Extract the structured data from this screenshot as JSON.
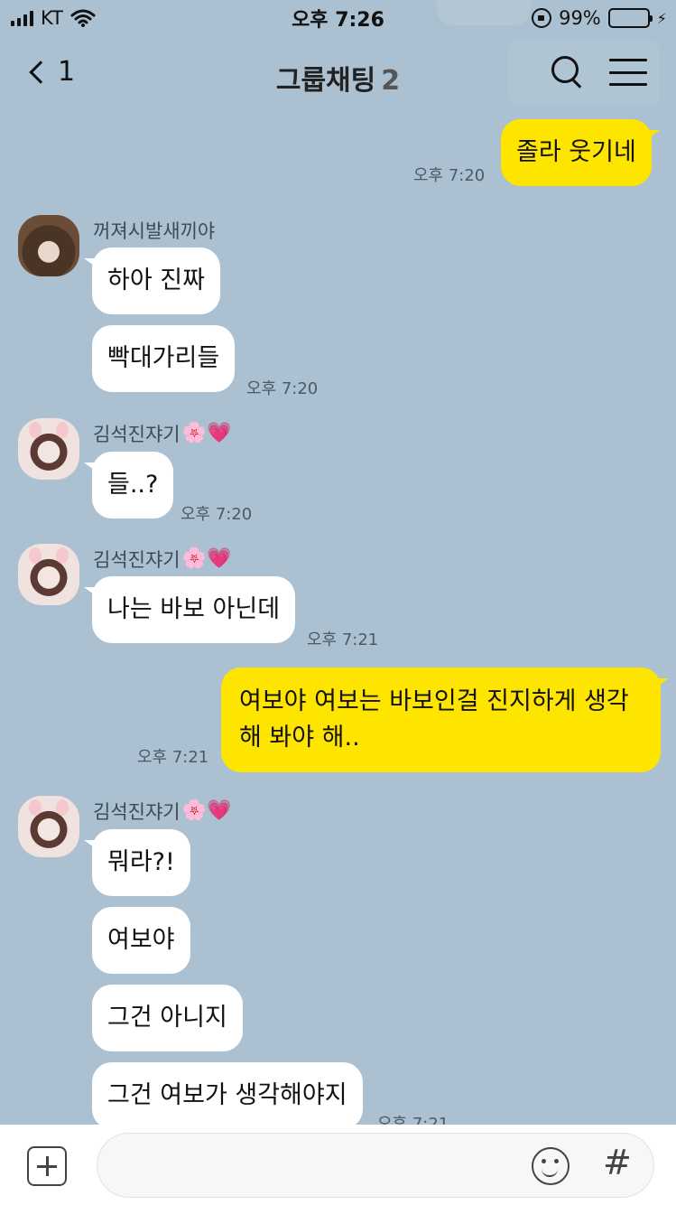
{
  "status_bar": {
    "carrier": "KT",
    "time": "오후 7:26",
    "battery": "99%",
    "battery_level": 0.99,
    "icons": [
      "signal-icon",
      "wifi-icon",
      "rotation-lock-icon",
      "battery-icon",
      "charging-icon"
    ]
  },
  "header": {
    "back_count": "1",
    "title": "그룹채팅",
    "member_count": "2",
    "icons": [
      "back-chevron-icon",
      "search-icon",
      "menu-icon"
    ]
  },
  "messages": [
    {
      "id": "m1",
      "direction": "out",
      "text": "졸라 웃기네",
      "time": "오후 7:20"
    },
    {
      "id": "m2",
      "direction": "in",
      "sender": "꺼져시발새끼야",
      "text": "하아 진짜"
    },
    {
      "id": "m3",
      "direction": "in",
      "text": "빡대가리들",
      "time": "오후 7:20"
    },
    {
      "id": "m4",
      "direction": "in",
      "sender": "김석진쟈기",
      "sender_emojis": "🌸💗",
      "text": "들..?",
      "time": "오후 7:20"
    },
    {
      "id": "m5",
      "direction": "in",
      "sender": "김석진쟈기",
      "sender_emojis": "🌸💗",
      "text": "나는 바보 아닌데",
      "time": "오후 7:21"
    },
    {
      "id": "m6",
      "direction": "out",
      "text": "여보야 여보는 바보인걸 진지하게 생각해 봐야 해..",
      "time": "오후 7:21"
    },
    {
      "id": "m7",
      "direction": "in",
      "sender": "김석진쟈기",
      "sender_emojis": "🌸💗",
      "text": "뭐라?!"
    },
    {
      "id": "m8",
      "direction": "in",
      "text": "여보야"
    },
    {
      "id": "m9",
      "direction": "in",
      "text": "그건 아니지"
    },
    {
      "id": "m10",
      "direction": "in",
      "text": "그건 여보가 생각해야지",
      "time": "오후 7:21"
    }
  ],
  "input_bar": {
    "placeholder": "",
    "icons": [
      "plus-icon",
      "emoji-icon",
      "hashtag-icon"
    ],
    "hash_glyph": "#"
  },
  "colors": {
    "background": "#abc1d1",
    "outgoing_bubble": "#fee500",
    "incoming_bubble": "#ffffff"
  }
}
